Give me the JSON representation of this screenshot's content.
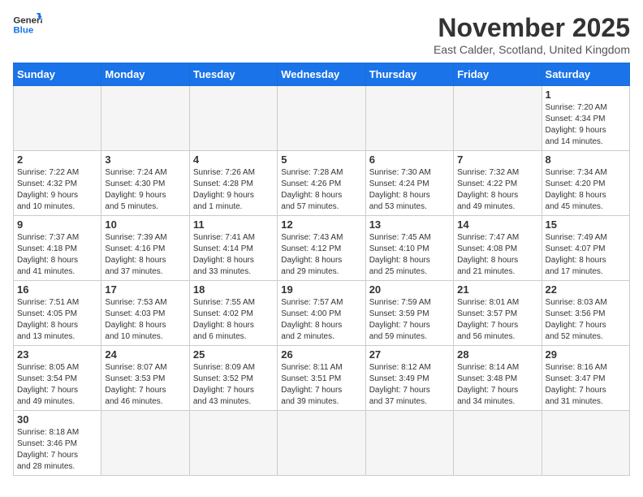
{
  "header": {
    "logo_general": "General",
    "logo_blue": "Blue",
    "month_title": "November 2025",
    "subtitle": "East Calder, Scotland, United Kingdom"
  },
  "weekdays": [
    "Sunday",
    "Monday",
    "Tuesday",
    "Wednesday",
    "Thursday",
    "Friday",
    "Saturday"
  ],
  "weeks": [
    [
      {
        "day": "",
        "info": ""
      },
      {
        "day": "",
        "info": ""
      },
      {
        "day": "",
        "info": ""
      },
      {
        "day": "",
        "info": ""
      },
      {
        "day": "",
        "info": ""
      },
      {
        "day": "",
        "info": ""
      },
      {
        "day": "1",
        "info": "Sunrise: 7:20 AM\nSunset: 4:34 PM\nDaylight: 9 hours\nand 14 minutes."
      }
    ],
    [
      {
        "day": "2",
        "info": "Sunrise: 7:22 AM\nSunset: 4:32 PM\nDaylight: 9 hours\nand 10 minutes."
      },
      {
        "day": "3",
        "info": "Sunrise: 7:24 AM\nSunset: 4:30 PM\nDaylight: 9 hours\nand 5 minutes."
      },
      {
        "day": "4",
        "info": "Sunrise: 7:26 AM\nSunset: 4:28 PM\nDaylight: 9 hours\nand 1 minute."
      },
      {
        "day": "5",
        "info": "Sunrise: 7:28 AM\nSunset: 4:26 PM\nDaylight: 8 hours\nand 57 minutes."
      },
      {
        "day": "6",
        "info": "Sunrise: 7:30 AM\nSunset: 4:24 PM\nDaylight: 8 hours\nand 53 minutes."
      },
      {
        "day": "7",
        "info": "Sunrise: 7:32 AM\nSunset: 4:22 PM\nDaylight: 8 hours\nand 49 minutes."
      },
      {
        "day": "8",
        "info": "Sunrise: 7:34 AM\nSunset: 4:20 PM\nDaylight: 8 hours\nand 45 minutes."
      }
    ],
    [
      {
        "day": "9",
        "info": "Sunrise: 7:37 AM\nSunset: 4:18 PM\nDaylight: 8 hours\nand 41 minutes."
      },
      {
        "day": "10",
        "info": "Sunrise: 7:39 AM\nSunset: 4:16 PM\nDaylight: 8 hours\nand 37 minutes."
      },
      {
        "day": "11",
        "info": "Sunrise: 7:41 AM\nSunset: 4:14 PM\nDaylight: 8 hours\nand 33 minutes."
      },
      {
        "day": "12",
        "info": "Sunrise: 7:43 AM\nSunset: 4:12 PM\nDaylight: 8 hours\nand 29 minutes."
      },
      {
        "day": "13",
        "info": "Sunrise: 7:45 AM\nSunset: 4:10 PM\nDaylight: 8 hours\nand 25 minutes."
      },
      {
        "day": "14",
        "info": "Sunrise: 7:47 AM\nSunset: 4:08 PM\nDaylight: 8 hours\nand 21 minutes."
      },
      {
        "day": "15",
        "info": "Sunrise: 7:49 AM\nSunset: 4:07 PM\nDaylight: 8 hours\nand 17 minutes."
      }
    ],
    [
      {
        "day": "16",
        "info": "Sunrise: 7:51 AM\nSunset: 4:05 PM\nDaylight: 8 hours\nand 13 minutes."
      },
      {
        "day": "17",
        "info": "Sunrise: 7:53 AM\nSunset: 4:03 PM\nDaylight: 8 hours\nand 10 minutes."
      },
      {
        "day": "18",
        "info": "Sunrise: 7:55 AM\nSunset: 4:02 PM\nDaylight: 8 hours\nand 6 minutes."
      },
      {
        "day": "19",
        "info": "Sunrise: 7:57 AM\nSunset: 4:00 PM\nDaylight: 8 hours\nand 2 minutes."
      },
      {
        "day": "20",
        "info": "Sunrise: 7:59 AM\nSunset: 3:59 PM\nDaylight: 7 hours\nand 59 minutes."
      },
      {
        "day": "21",
        "info": "Sunrise: 8:01 AM\nSunset: 3:57 PM\nDaylight: 7 hours\nand 56 minutes."
      },
      {
        "day": "22",
        "info": "Sunrise: 8:03 AM\nSunset: 3:56 PM\nDaylight: 7 hours\nand 52 minutes."
      }
    ],
    [
      {
        "day": "23",
        "info": "Sunrise: 8:05 AM\nSunset: 3:54 PM\nDaylight: 7 hours\nand 49 minutes."
      },
      {
        "day": "24",
        "info": "Sunrise: 8:07 AM\nSunset: 3:53 PM\nDaylight: 7 hours\nand 46 minutes."
      },
      {
        "day": "25",
        "info": "Sunrise: 8:09 AM\nSunset: 3:52 PM\nDaylight: 7 hours\nand 43 minutes."
      },
      {
        "day": "26",
        "info": "Sunrise: 8:11 AM\nSunset: 3:51 PM\nDaylight: 7 hours\nand 39 minutes."
      },
      {
        "day": "27",
        "info": "Sunrise: 8:12 AM\nSunset: 3:49 PM\nDaylight: 7 hours\nand 37 minutes."
      },
      {
        "day": "28",
        "info": "Sunrise: 8:14 AM\nSunset: 3:48 PM\nDaylight: 7 hours\nand 34 minutes."
      },
      {
        "day": "29",
        "info": "Sunrise: 8:16 AM\nSunset: 3:47 PM\nDaylight: 7 hours\nand 31 minutes."
      }
    ],
    [
      {
        "day": "30",
        "info": "Sunrise: 8:18 AM\nSunset: 3:46 PM\nDaylight: 7 hours\nand 28 minutes."
      },
      {
        "day": "",
        "info": ""
      },
      {
        "day": "",
        "info": ""
      },
      {
        "day": "",
        "info": ""
      },
      {
        "day": "",
        "info": ""
      },
      {
        "day": "",
        "info": ""
      },
      {
        "day": "",
        "info": ""
      }
    ]
  ]
}
